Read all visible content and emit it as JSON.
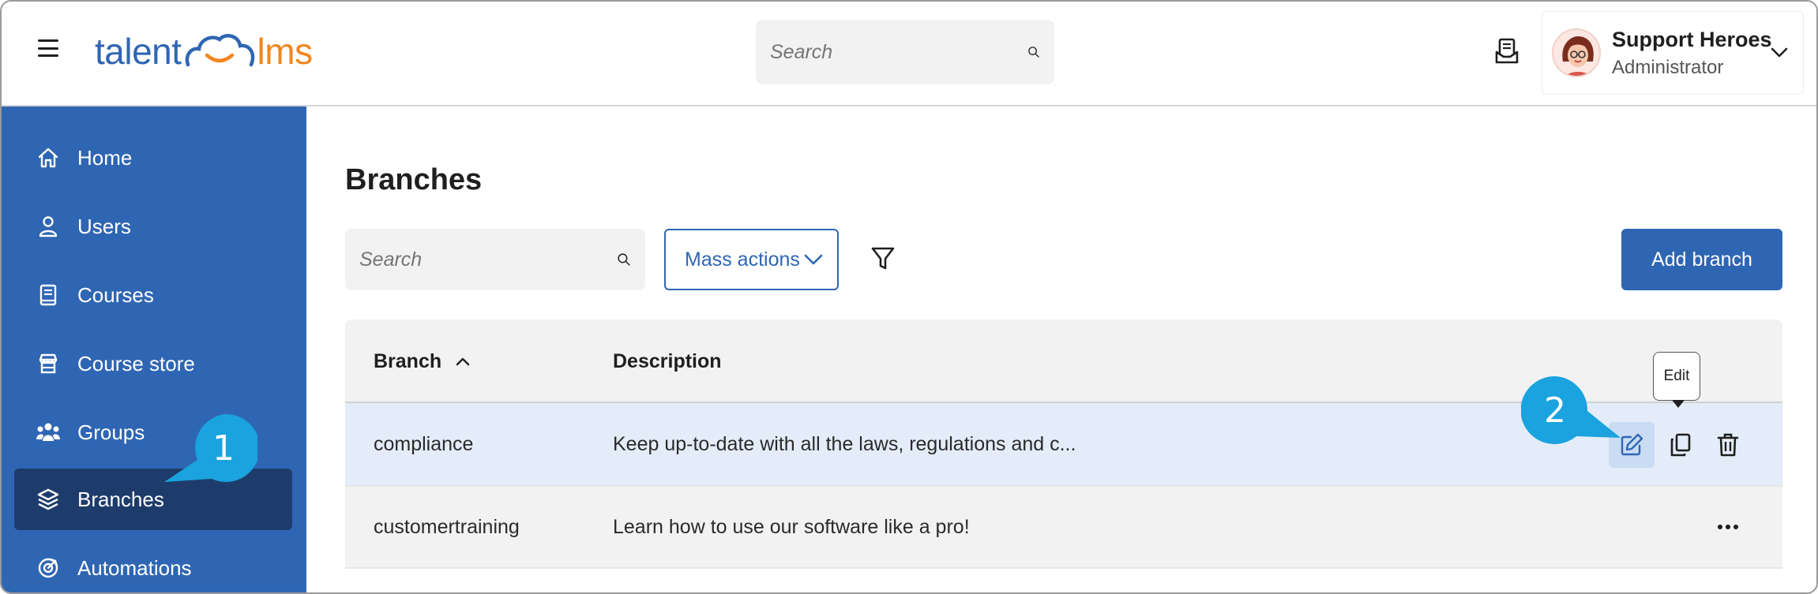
{
  "header": {
    "logo_left": "talent",
    "logo_right": "lms",
    "search_placeholder": "Search",
    "user": {
      "name": "Support Heroes",
      "role": "Administrator"
    }
  },
  "sidebar": {
    "items": [
      {
        "label": "Home",
        "icon": "home-icon"
      },
      {
        "label": "Users",
        "icon": "user-icon"
      },
      {
        "label": "Courses",
        "icon": "book-icon"
      },
      {
        "label": "Course store",
        "icon": "store-icon"
      },
      {
        "label": "Groups",
        "icon": "groups-icon"
      },
      {
        "label": "Branches",
        "icon": "layers-icon",
        "active": true
      },
      {
        "label": "Automations",
        "icon": "automation-icon"
      }
    ]
  },
  "main": {
    "title": "Branches",
    "search_placeholder": "Search",
    "mass_actions_label": "Mass actions",
    "add_button_label": "Add branch",
    "table": {
      "columns": [
        "Branch",
        "Description"
      ],
      "rows": [
        {
          "branch": "compliance",
          "description": "Keep up-to-date with all the laws, regulations and c..."
        },
        {
          "branch": "customertraining",
          "description": "Learn how to use our software like a pro!"
        }
      ]
    },
    "tooltip": "Edit"
  },
  "callouts": [
    "1",
    "2"
  ],
  "colors": {
    "brand_blue": "#2f66b3",
    "sidebar_active": "#1e3c6b",
    "logo_orange": "#f2861f",
    "callout_cyan": "#1aa3de"
  }
}
